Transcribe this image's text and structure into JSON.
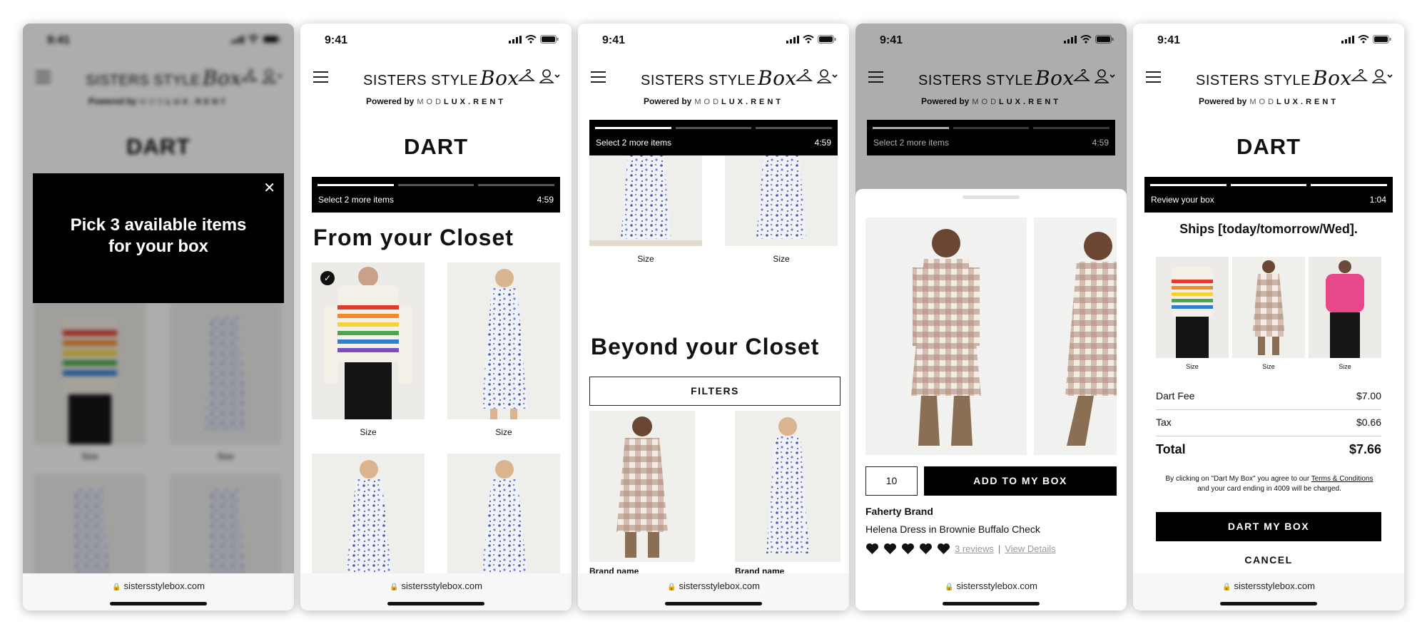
{
  "common": {
    "time": "9:41",
    "brand_main": "SISTERS STYLE",
    "brand_script": "Box",
    "powered_by": "Powered by",
    "powered_mod": "MOD",
    "powered_lux": "LUX.RENT",
    "dart_logo": "DART",
    "url": "sistersstylebox.com",
    "size_label": "Size",
    "brand_name_label": "Brand name"
  },
  "screen1": {
    "modal_message": "Pick 3 available items for your box",
    "close_icon": "close-icon",
    "size_label": "Size"
  },
  "screen2": {
    "progress_label": "Select 2 more items",
    "progress_time": "4:59",
    "progress_filled": 1,
    "section_title": "From your Closet",
    "items": [
      {
        "caption": "Size",
        "selected": true
      },
      {
        "caption": "Size",
        "selected": false
      }
    ]
  },
  "screen3": {
    "progress_label": "Select 2 more items",
    "progress_time": "4:59",
    "progress_filled": 1,
    "section_title": "Beyond your Closet",
    "filters_label": "FILTERS",
    "sizes": [
      "Size",
      "Size"
    ],
    "brand_labels": [
      "Brand name",
      "Brand name"
    ]
  },
  "screen4": {
    "progress_label": "Select 2 more items",
    "progress_time": "4:59",
    "progress_filled": 1,
    "quantity": "10",
    "add_label": "ADD TO MY BOX",
    "product_brand": "Faherty Brand",
    "product_name": "Helena Dress in Brownie Buffalo Check",
    "rating": 5,
    "reviews_link": "3 reviews",
    "separator": "|",
    "details_link": "View Details"
  },
  "screen5": {
    "progress_label": "Review your box",
    "progress_time": "1:04",
    "progress_filled": 3,
    "ships_text": "Ships [today/tomorrow/Wed].",
    "sizes": [
      "Size",
      "Size",
      "Size"
    ],
    "fees": [
      {
        "label": "Dart Fee",
        "value": "$7.00"
      },
      {
        "label": "Tax",
        "value": "$0.66"
      }
    ],
    "total_label": "Total",
    "total_value": "$7.66",
    "terms_pre": "By clicking on \"Dart My Box\" you agree to our",
    "terms_link": "Terms & Conditions",
    "terms_post": "and your card ending in 4009 will be charged.",
    "dart_button": "DART MY BOX",
    "cancel_button": "CANCEL"
  },
  "colors": {
    "accent": "#000000",
    "sweater_stripes": [
      "#e23b2e",
      "#f28a2a",
      "#f5d33a",
      "#4aa84c",
      "#2f7fd1",
      "#7b4fc4"
    ],
    "pink_jacket": "#e8478a",
    "buffalo_check": "#b99a8a"
  }
}
